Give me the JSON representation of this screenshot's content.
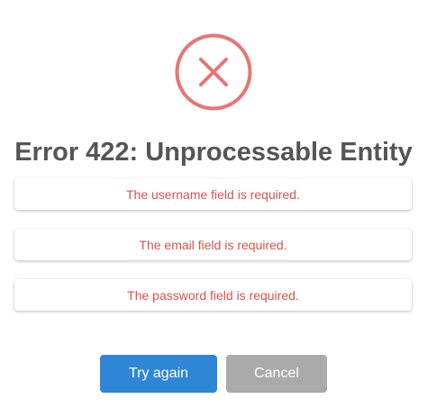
{
  "error": {
    "icon": "close-circle-icon",
    "title": "Error 422: Unprocessable Entity",
    "messages": [
      "The username field is required.",
      "The email field is required.",
      "The password field is required."
    ]
  },
  "actions": {
    "retry_label": "Try again",
    "cancel_label": "Cancel"
  },
  "colors": {
    "error_red": "#e87575",
    "message_text": "#d9534f",
    "title_text": "#555555",
    "primary_button": "#2f86d6",
    "secondary_button": "#aaaaaa"
  }
}
